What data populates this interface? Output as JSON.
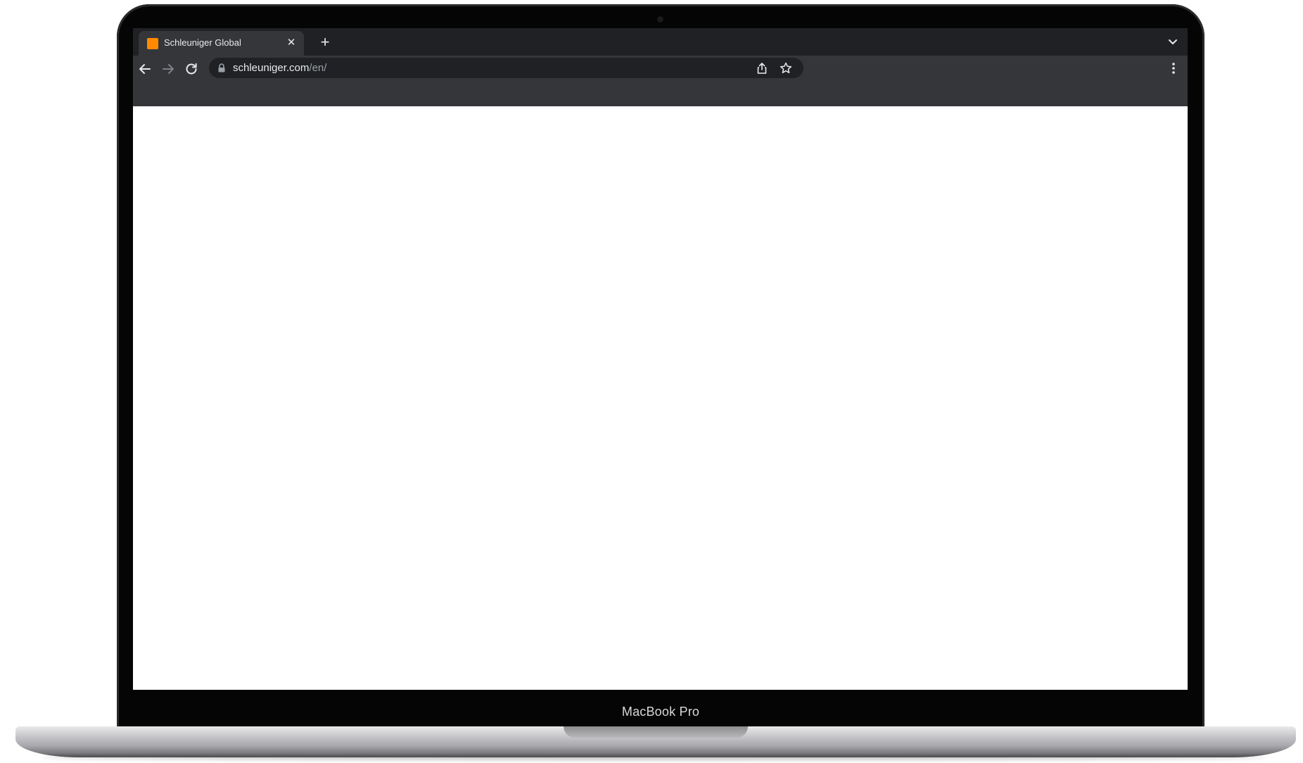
{
  "device": {
    "label": "MacBook Pro"
  },
  "browser": {
    "tab": {
      "title": "Schleuniger Global",
      "favicon_color": "#ff8a00"
    },
    "address_bar": {
      "host": "schleuniger.com",
      "path": "/en/"
    },
    "icons": {
      "close": "close-icon",
      "new_tab": "plus-icon",
      "tab_search": "chevron-down-icon",
      "back": "arrow-left-icon",
      "forward": "arrow-right-icon",
      "reload": "reload-icon",
      "lock": "lock-icon",
      "share": "share-icon",
      "bookmark": "star-icon",
      "menu": "kebab-menu-icon"
    }
  },
  "colors": {
    "tabstrip": "#202124",
    "toolbar": "#35363a",
    "omnibox": "#202124",
    "text": "#e8eaed",
    "muted_text": "#9aa0a6",
    "bezel": "#050505"
  }
}
